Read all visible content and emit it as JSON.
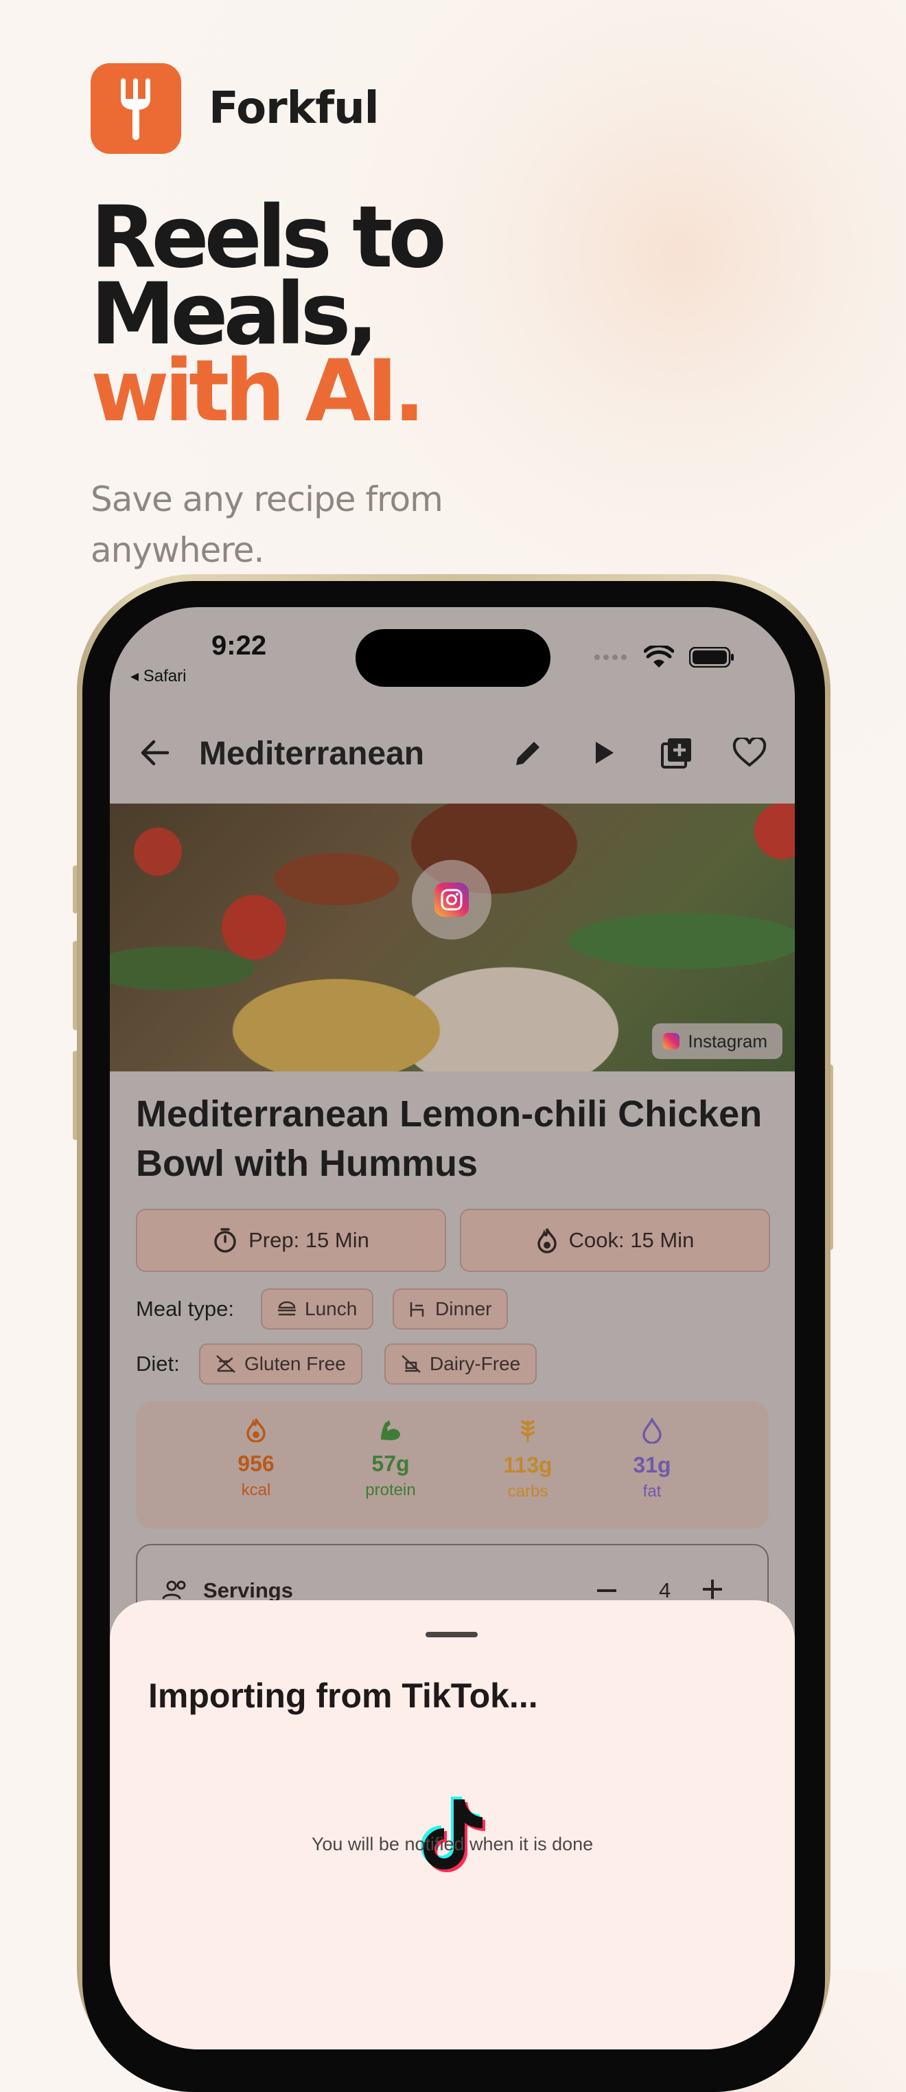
{
  "brand": {
    "name": "Forkful",
    "logo_icon": "fork-icon",
    "accent": "#ec6b35"
  },
  "headline": {
    "line1": "Reels to",
    "line2": "Meals,",
    "line3": "with AI."
  },
  "subhead": "Save any recipe from anywhere.",
  "status_bar": {
    "time": "9:22",
    "back_label": "◂ Safari"
  },
  "app_bar": {
    "title": "Mediterranean"
  },
  "hero": {
    "source_tag": "Instagram"
  },
  "recipe": {
    "title": "Mediterranean Lemon-chili Chicken Bowl with Hummus",
    "prep": "Prep: 15 Min",
    "cook": "Cook: 15 Min",
    "meal_type_label": "Meal type:",
    "meal_types": [
      "Lunch",
      "Dinner"
    ],
    "diet_label": "Diet:",
    "diets": [
      "Gluten Free",
      "Dairy-Free"
    ],
    "nutrition": [
      {
        "value": "956",
        "label": "kcal",
        "color": "#b85a1c"
      },
      {
        "value": "57g",
        "label": "protein",
        "color": "#3f7d36"
      },
      {
        "value": "113g",
        "label": "carbs",
        "color": "#c08a2c"
      },
      {
        "value": "31g",
        "label": "fat",
        "color": "#6f5aa8"
      }
    ],
    "servings_label": "Servings",
    "servings_value": "4"
  },
  "sheet": {
    "title": "Importing from TikTok...",
    "note": "You will be notified when it is done"
  }
}
